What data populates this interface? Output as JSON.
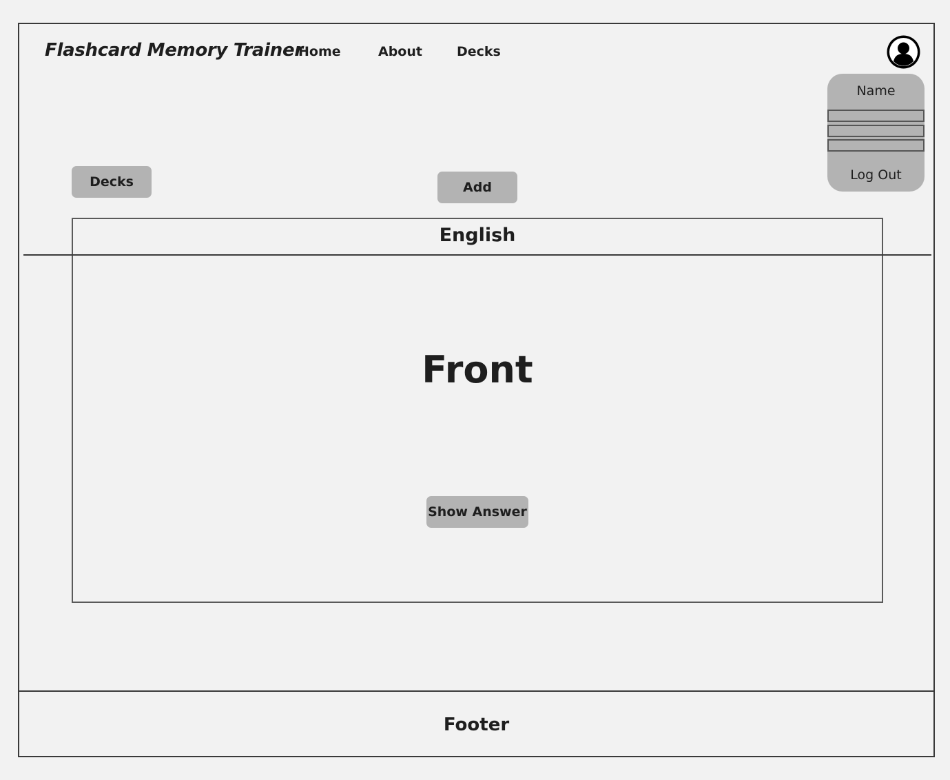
{
  "header": {
    "app_title": "Flashcard Memory Trainer",
    "nav": [
      {
        "label": "Home"
      },
      {
        "label": "About"
      },
      {
        "label": "Decks"
      }
    ]
  },
  "user_menu": {
    "avatar_icon": "user-avatar-icon",
    "name": "Name",
    "logout_label": "Log Out"
  },
  "toolbar": {
    "decks_label": "Decks",
    "add_label": "Add"
  },
  "card": {
    "deck_name": "English",
    "face_text": "Front",
    "show_answer_label": "Show Answer"
  },
  "footer": {
    "label": "Footer"
  },
  "colors": {
    "background": "#f2f2f2",
    "button": "#b3b3b3",
    "border": "#3a3a3a",
    "text": "#1e1e1e"
  }
}
